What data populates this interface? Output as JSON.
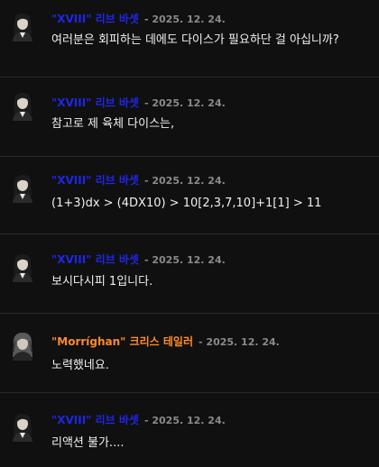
{
  "comments": [
    {
      "author": "\"XVIII\" 리브 바셋",
      "author_color": "#1f26e8",
      "date": "- 2025. 12. 24.",
      "text": "여러분은 회피하는 데에도 다이스가 필요하단 걸 아십니까?",
      "avatar": "dark-haired-avatar-icon"
    },
    {
      "author": "\"XVIII\" 리브 바셋",
      "author_color": "#1f26e8",
      "date": "- 2025. 12. 24.",
      "text": "참고로 제 육체 다이스는,",
      "avatar": "dark-haired-avatar-icon"
    },
    {
      "author": "\"XVIII\" 리브 바셋",
      "author_color": "#1f26e8",
      "date": "- 2025. 12. 24.",
      "text": "(1+3)dx > (4DX10) > 10[2,3,7,10]+1[1] > 11",
      "avatar": "dark-haired-avatar-icon"
    },
    {
      "author": "\"XVIII\" 리브 바셋",
      "author_color": "#1f26e8",
      "date": "- 2025. 12. 24.",
      "text": "보시다시피 1입니다.",
      "avatar": "dark-haired-avatar-icon"
    },
    {
      "author": "\"Morríghan\" 크리스 테일러",
      "author_color": "#ff8a2b",
      "date": "- 2025. 12. 24.",
      "text": "노력했네요.",
      "avatar": "grey-haired-avatar-icon"
    },
    {
      "author": "\"XVIII\" 리브 바셋",
      "author_color": "#1f26e8",
      "date": "- 2025. 12. 24.",
      "text": "리액션 불가....",
      "avatar": "dark-haired-avatar-icon"
    }
  ]
}
